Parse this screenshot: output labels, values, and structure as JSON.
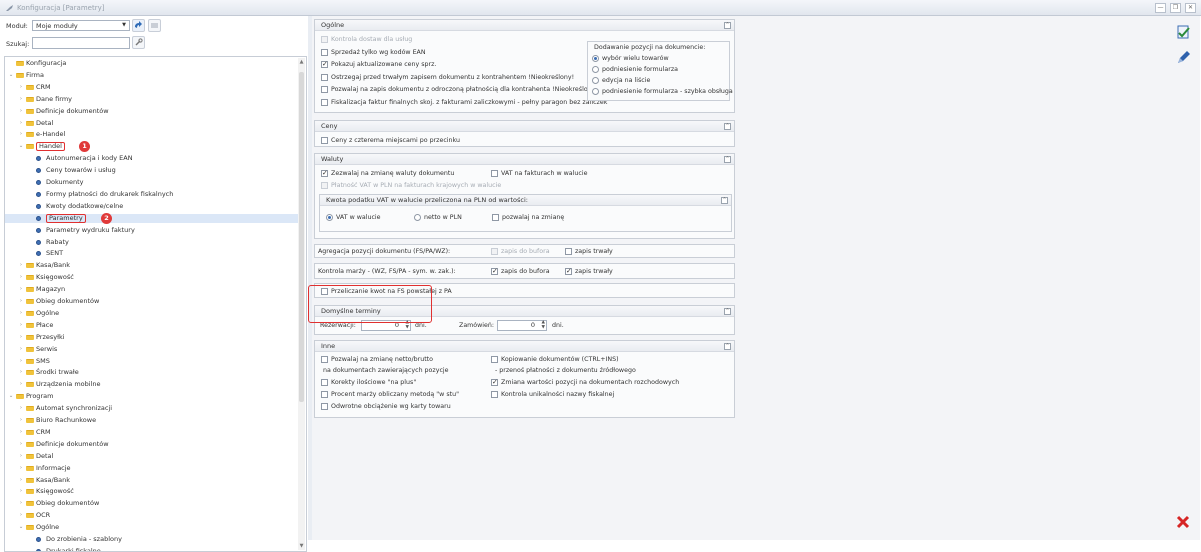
{
  "window": {
    "title": "Konfiguracja [Parametry]"
  },
  "left": {
    "module_label": "Moduł:",
    "module_value": "Moje moduły",
    "search_label": "Szukaj:",
    "search_value": ""
  },
  "tree": [
    {
      "label": "Konfiguracja",
      "level": 0,
      "type": "folder",
      "exp": ""
    },
    {
      "label": "Firma",
      "level": 0,
      "type": "folder",
      "exp": "open"
    },
    {
      "label": "CRM",
      "level": 1,
      "type": "folder",
      "exp": "closed"
    },
    {
      "label": "Dane firmy",
      "level": 1,
      "type": "folder",
      "exp": "closed"
    },
    {
      "label": "Definicje dokumentów",
      "level": 1,
      "type": "folder",
      "exp": "closed"
    },
    {
      "label": "Detal",
      "level": 1,
      "type": "folder",
      "exp": "closed"
    },
    {
      "label": "e-Handel",
      "level": 1,
      "type": "folder",
      "exp": "closed"
    },
    {
      "label": "Handel",
      "level": 1,
      "type": "folder",
      "exp": "open",
      "hl": true,
      "badge": "1"
    },
    {
      "label": "Autonumeracja i kody EAN",
      "level": 2,
      "type": "doc",
      "exp": ""
    },
    {
      "label": "Ceny towarów i usług",
      "level": 2,
      "type": "doc",
      "exp": ""
    },
    {
      "label": "Dokumenty",
      "level": 2,
      "type": "doc",
      "exp": ""
    },
    {
      "label": "Formy płatności do drukarek fiskalnych",
      "level": 2,
      "type": "doc",
      "exp": ""
    },
    {
      "label": "Kwoty dodatkowe/celne",
      "level": 2,
      "type": "doc",
      "exp": ""
    },
    {
      "label": "Parametry",
      "level": 2,
      "type": "doc",
      "exp": "",
      "hl": true,
      "sel": true,
      "badge": "2"
    },
    {
      "label": "Parametry wydruku faktury",
      "level": 2,
      "type": "doc",
      "exp": ""
    },
    {
      "label": "Rabaty",
      "level": 2,
      "type": "doc",
      "exp": ""
    },
    {
      "label": "SENT",
      "level": 2,
      "type": "doc",
      "exp": ""
    },
    {
      "label": "Kasa/Bank",
      "level": 1,
      "type": "folder",
      "exp": "closed"
    },
    {
      "label": "Księgowość",
      "level": 1,
      "type": "folder",
      "exp": "closed"
    },
    {
      "label": "Magazyn",
      "level": 1,
      "type": "folder",
      "exp": "closed"
    },
    {
      "label": "Obieg dokumentów",
      "level": 1,
      "type": "folder",
      "exp": "closed"
    },
    {
      "label": "Ogólne",
      "level": 1,
      "type": "folder",
      "exp": "closed"
    },
    {
      "label": "Płace",
      "level": 1,
      "type": "folder",
      "exp": "closed"
    },
    {
      "label": "Przesyłki",
      "level": 1,
      "type": "folder",
      "exp": "closed"
    },
    {
      "label": "Serwis",
      "level": 1,
      "type": "folder",
      "exp": "closed"
    },
    {
      "label": "SMS",
      "level": 1,
      "type": "folder",
      "exp": "closed"
    },
    {
      "label": "Środki trwałe",
      "level": 1,
      "type": "folder",
      "exp": "closed"
    },
    {
      "label": "Urządzenia mobilne",
      "level": 1,
      "type": "folder",
      "exp": "closed"
    },
    {
      "label": "Program",
      "level": 0,
      "type": "folder",
      "exp": "open"
    },
    {
      "label": "Automat synchronizacji",
      "level": 1,
      "type": "folder",
      "exp": "closed"
    },
    {
      "label": "Biuro Rachunkowe",
      "level": 1,
      "type": "folder",
      "exp": "closed"
    },
    {
      "label": "CRM",
      "level": 1,
      "type": "folder",
      "exp": "closed"
    },
    {
      "label": "Definicje dokumentów",
      "level": 1,
      "type": "folder",
      "exp": "closed"
    },
    {
      "label": "Detal",
      "level": 1,
      "type": "folder",
      "exp": "closed"
    },
    {
      "label": "Informacje",
      "level": 1,
      "type": "folder",
      "exp": "closed"
    },
    {
      "label": "Kasa/Bank",
      "level": 1,
      "type": "folder",
      "exp": "closed"
    },
    {
      "label": "Księgowość",
      "level": 1,
      "type": "folder",
      "exp": "closed"
    },
    {
      "label": "Obieg dokumentów",
      "level": 1,
      "type": "folder",
      "exp": "closed"
    },
    {
      "label": "OCR",
      "level": 1,
      "type": "folder",
      "exp": "closed"
    },
    {
      "label": "Ogólne",
      "level": 1,
      "type": "folder",
      "exp": "open"
    },
    {
      "label": "Do zrobienia - szablony",
      "level": 2,
      "type": "doc",
      "exp": ""
    },
    {
      "label": "Drukarki fiskalne",
      "level": 2,
      "type": "doc",
      "exp": ""
    }
  ],
  "ogolne": {
    "title": "Ogólne",
    "items": [
      {
        "label": "Kontrola dostaw dla usług",
        "checked": false,
        "disabled": true
      },
      {
        "label": "Sprzedaż tylko wg kodów EAN",
        "checked": false,
        "disabled": false
      },
      {
        "label": "Pokazuj aktualizowane ceny sprz.",
        "checked": true,
        "disabled": false
      },
      {
        "label": "Ostrzegaj przed trwałym zapisem dokumentu z kontrahentem !Nieokreślony!",
        "checked": false,
        "disabled": false
      },
      {
        "label": "Pozwalaj na zapis dokumentu z odroczoną płatnością dla kontrahenta !Nieokreślony!",
        "checked": false,
        "disabled": false
      },
      {
        "label": "Fiskalizacja faktur finalnych skoj. z fakturami zaliczkowymi - pełny paragon bez zaliczek",
        "checked": false,
        "disabled": false
      }
    ],
    "dodawanie_title": "Dodawanie pozycji na dokumencie:",
    "dodawanie": [
      {
        "label": "wybór wielu towarów",
        "on": true
      },
      {
        "label": "podniesienie formularza",
        "on": false
      },
      {
        "label": "edycja na liście",
        "on": false
      },
      {
        "label": "podniesienie formularza - szybka obsługa",
        "on": false
      }
    ]
  },
  "ceny": {
    "title": "Ceny",
    "item": "Ceny z czterema miejscami po przecinku"
  },
  "waluty": {
    "title": "Waluty",
    "zezwalaj": "Zezwalaj na zmianę waluty dokumentu",
    "vat_fakt": "VAT na fakturach w walucie",
    "platnosc": "Płatność VAT w PLN na fakturach krajowych w walucie",
    "kwota_title": "Kwota podatku VAT w walucie przeliczona na PLN od wartości:",
    "vat_w_walucie": "VAT w walucie",
    "netto_pln": "netto w PLN",
    "pozwalaj_zmiane": "pozwalaj na zmianę"
  },
  "agregacja": {
    "label": "Agregacja pozycji dokumentu (FS/PA/WZ):",
    "bufor": "zapis do bufora",
    "trwaly": "zapis trwały"
  },
  "kontrola": {
    "label": "Kontrola marży - (WZ, FS/PA - sym. w. zak.):",
    "bufor": "zapis do bufora",
    "trwaly": "zapis trwały"
  },
  "przeliczanie": "Przeliczanie kwot na FS powstałej z PA",
  "terminy": {
    "title": "Domyślne terminy",
    "rez_label": "Rezerwacji:",
    "rez_value": "0",
    "rez_unit": "dni.",
    "zam_label": "Zamówień:",
    "zam_value": "0",
    "zam_unit": "dni."
  },
  "inne": {
    "title": "Inne",
    "l1": "Pozwalaj na zmianę netto/brutto",
    "l1b": "na dokumentach zawierających pozycje",
    "l2": "Korekty ilościowe \"na plus\"",
    "l3": "Procent marży obliczany metodą \"w stu\"",
    "l4": "Odwrotne obciążenie wg karty towaru",
    "r1": "Kopiowanie dokumentów (CTRL+INS)",
    "r1b": "- przenoś płatności z dokumentu źródłowego",
    "r2": "Zmiana wartości pozycji na dokumentach rozchodowych",
    "r3": "Kontrola unikalności nazwy fiskalnej"
  },
  "colors": {
    "highlight": "#e03030",
    "accent": "#3b6db3"
  }
}
